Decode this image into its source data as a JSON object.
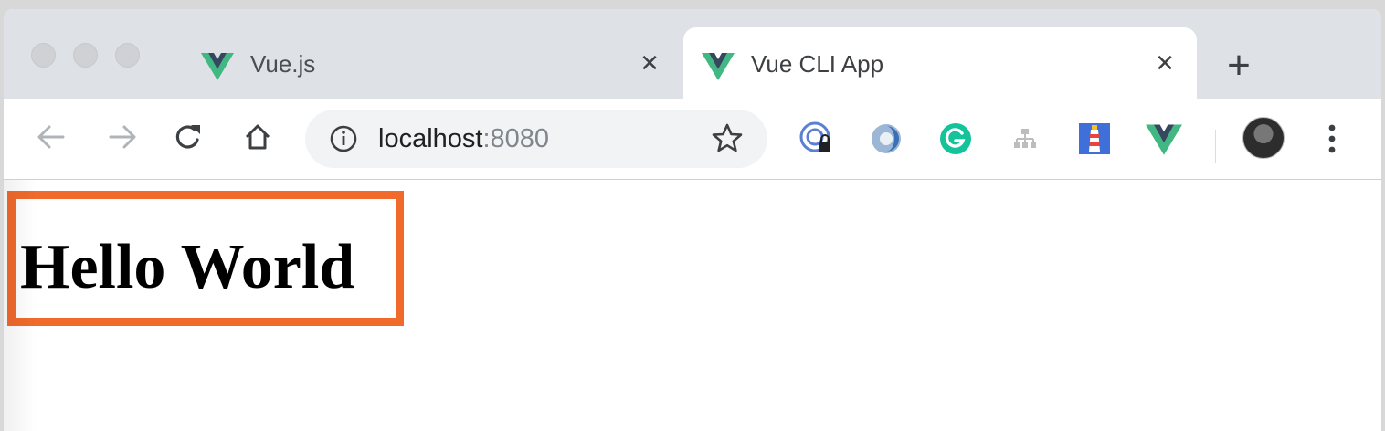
{
  "browser": {
    "tabs": [
      {
        "title": "Vue.js",
        "active": false,
        "favicon": "vue-logo-icon"
      },
      {
        "title": "Vue CLI App",
        "active": true,
        "favicon": "vue-logo-icon"
      }
    ],
    "close_glyph": "×",
    "new_tab_glyph": "+",
    "address": {
      "host": "localhost",
      "port": ":8080"
    },
    "nav_icons": [
      "back-arrow-icon",
      "forward-arrow-icon",
      "reload-icon",
      "home-icon"
    ],
    "extensions": [
      "password-manager-extension-icon",
      "colorful-circle-extension-icon",
      "grammarly-extension-icon",
      "sitemap-extension-icon",
      "lighthouse-extension-icon",
      "vue-devtools-extension-icon"
    ]
  },
  "page": {
    "heading": "Hello World"
  },
  "colors": {
    "highlight_border": "#f06a2c",
    "vue_green": "#41b883",
    "vue_dark": "#35495e",
    "tabstrip_bg": "#dee1e6"
  }
}
